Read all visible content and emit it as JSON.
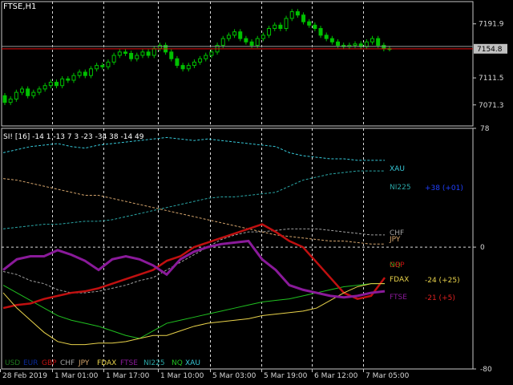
{
  "app": {
    "symbol_title": "FTSE,H1",
    "indicator_header": "SI! [16] -14 1 -13 7 3 -23 -34 38 -14 49"
  },
  "colors": {
    "background": "#000000",
    "grid": "#ffffff",
    "candle": "#00c000",
    "price_line": "#e01010",
    "axis_text": "#d8d8d8",
    "price_label_bg": "#c0c0c0"
  },
  "price_panel": {
    "y_ticks": [
      "7191.9",
      "7111.5",
      "7071.3"
    ],
    "current_price": "7154.8"
  },
  "indicator_panel": {
    "y_ticks": [
      "78",
      "0",
      "-80"
    ]
  },
  "time_axis": [
    "28 Feb 2019",
    "1 Mar 01:00",
    "1 Mar 17:00",
    "1 Mar 10:00",
    "5 Mar 03:00",
    "5 Mar 19:00",
    "6 Mar 12:00",
    "7 Mar 05:00"
  ],
  "legend": [
    {
      "label": "USD",
      "color": "#1f7a1f"
    },
    {
      "label": "EUR",
      "color": "#0a2a9a"
    },
    {
      "label": "GBP",
      "color": "#c01010"
    },
    {
      "label": "CHF",
      "color": "#a0a0a0"
    },
    {
      "label": "JPY",
      "color": "#d2a36b"
    },
    {
      "label": "FDAX",
      "color": "#e8d24a"
    },
    {
      "label": "FTSE",
      "color": "#8a1a9a"
    },
    {
      "label": "NI225",
      "color": "#2aa6a6"
    },
    {
      "label": "NQ",
      "color": "#20c020"
    },
    {
      "label": "XAU",
      "color": "#36c8d8"
    }
  ],
  "line_labels": [
    {
      "label": "XAU",
      "color": "#36c8d8"
    },
    {
      "label": "NI225",
      "color": "#2aa6a6"
    },
    {
      "label": "CHF",
      "color": "#a0a0a0"
    },
    {
      "label": "JPY",
      "color": "#d2a36b"
    },
    {
      "label": "NQ",
      "color": "#20c020"
    },
    {
      "label": "GBP",
      "color": "#c01010"
    },
    {
      "label": "FDAX",
      "color": "#e8d24a"
    },
    {
      "label": "FTSE",
      "color": "#8a1a9a"
    }
  ],
  "value_labels": [
    {
      "text": "+38 (+01)",
      "color": "#2040ff"
    },
    {
      "text": "-24 (+25)",
      "color": "#e8d24a"
    },
    {
      "text": "-21 (+5)",
      "color": "#e02020"
    }
  ],
  "chart_data": [
    {
      "type": "line",
      "title": "FTSE,H1",
      "ylim": [
        7040,
        7225
      ],
      "series": [
        {
          "name": "FTSE",
          "values": [
            7085,
            7075,
            7080,
            7090,
            7095,
            7085,
            7090,
            7095,
            7100,
            7105,
            7100,
            7110,
            7108,
            7115,
            7120,
            7115,
            7125,
            7130,
            7128,
            7135,
            7145,
            7150,
            7148,
            7140,
            7145,
            7150,
            7145,
            7155,
            7160,
            7150,
            7140,
            7130,
            7125,
            7130,
            7135,
            7140,
            7145,
            7150,
            7160,
            7170,
            7175,
            7180,
            7170,
            7165,
            7160,
            7170,
            7175,
            7185,
            7190,
            7185,
            7200,
            7210,
            7205,
            7195,
            7190,
            7185,
            7175,
            7170,
            7165,
            7160,
            7158,
            7160,
            7162,
            7158,
            7165,
            7170,
            7160,
            7155
          ]
        }
      ]
    },
    {
      "type": "line",
      "title": "",
      "ylim": [
        -80,
        78
      ],
      "series": [
        {
          "name": "XAU",
          "values": [
            62,
            64,
            66,
            67,
            68,
            66,
            65,
            67,
            68,
            69,
            70,
            71,
            72,
            71,
            70,
            71,
            70,
            69,
            68,
            67,
            66,
            62,
            60,
            59,
            58,
            58,
            57,
            57,
            57
          ]
        },
        {
          "name": "NI225",
          "values": [
            12,
            13,
            14,
            15,
            15,
            16,
            17,
            17,
            18,
            20,
            22,
            24,
            26,
            28,
            30,
            32,
            33,
            33,
            34,
            35,
            36,
            40,
            44,
            46,
            48,
            49,
            50,
            50,
            50
          ]
        },
        {
          "name": "CHF",
          "values": [
            -16,
            -18,
            -22,
            -24,
            -28,
            -30,
            -30,
            -29,
            -27,
            -25,
            -22,
            -20,
            -15,
            -10,
            -5,
            0,
            5,
            8,
            10,
            10,
            11,
            12,
            12,
            12,
            11,
            10,
            9,
            8,
            8
          ]
        },
        {
          "name": "JPY",
          "values": [
            45,
            44,
            42,
            40,
            38,
            36,
            34,
            34,
            32,
            30,
            28,
            26,
            24,
            22,
            20,
            18,
            16,
            14,
            12,
            10,
            8,
            7,
            6,
            5,
            4,
            4,
            3,
            2,
            2
          ]
        },
        {
          "name": "NQ",
          "values": [
            -25,
            -30,
            -35,
            -40,
            -45,
            -48,
            -50,
            -52,
            -55,
            -58,
            -60,
            -55,
            -50,
            -48,
            -46,
            -44,
            -42,
            -40,
            -38,
            -36,
            -35,
            -34,
            -32,
            -30,
            -28,
            -26,
            -25,
            -24,
            -24
          ]
        },
        {
          "name": "GBP",
          "values": [
            -40,
            -38,
            -37,
            -34,
            -32,
            -30,
            -29,
            -27,
            -24,
            -21,
            -18,
            -15,
            -9,
            -6,
            0,
            3,
            6,
            9,
            12,
            15,
            10,
            4,
            0,
            -10,
            -20,
            -30,
            -34,
            -32,
            -20
          ]
        },
        {
          "name": "FDAX",
          "values": [
            -30,
            -40,
            -48,
            -56,
            -62,
            -64,
            -64,
            -63,
            -63,
            -62,
            -60,
            -58,
            -58,
            -55,
            -52,
            -50,
            -49,
            -48,
            -47,
            -45,
            -44,
            -43,
            -42,
            -40,
            -35,
            -30,
            -26,
            -24,
            -24
          ]
        },
        {
          "name": "FTSE",
          "values": [
            -15,
            -8,
            -6,
            -6,
            -2,
            -5,
            -9,
            -15,
            -8,
            -6,
            -8,
            -12,
            -18,
            -8,
            -3,
            0,
            2,
            3,
            4,
            -8,
            -15,
            -25,
            -28,
            -30,
            -32,
            -33,
            -32,
            -30,
            -29
          ]
        }
      ]
    }
  ]
}
